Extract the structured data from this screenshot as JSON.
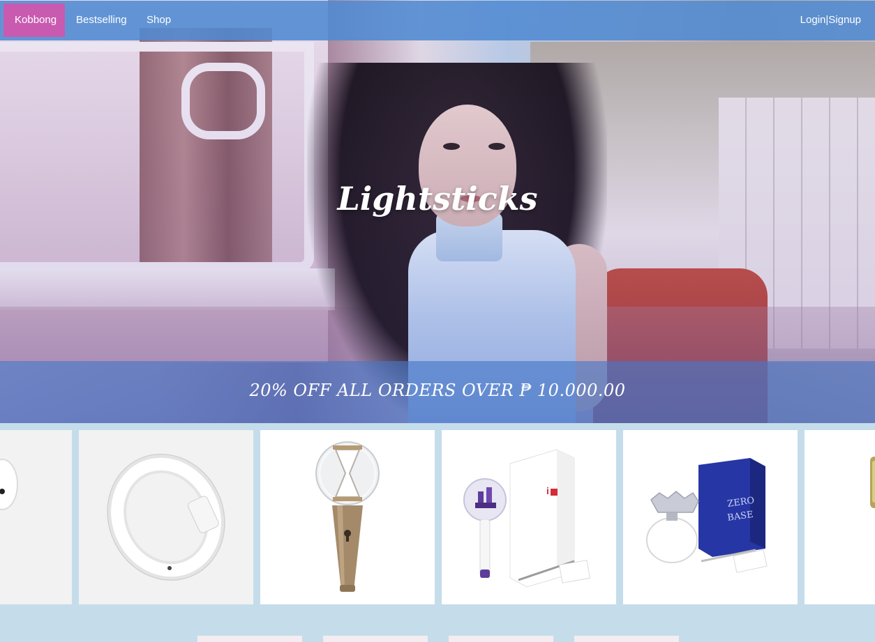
{
  "nav": {
    "brand": "Kobbong",
    "links": [
      "Bestselling",
      "Shop"
    ],
    "auth": {
      "login": "Login",
      "separator": "|",
      "signup": "Signup"
    }
  },
  "hero": {
    "title": "Lightsticks",
    "promo": "20% OFF ALL ORDERS OVER ₱ 10.000.00"
  },
  "products": [
    {
      "name": "lightstick-white-partial"
    },
    {
      "name": "lightstick-ring"
    },
    {
      "name": "lightstick-hourglass"
    },
    {
      "name": "lightstick-castle"
    },
    {
      "name": "lightstick-flower"
    },
    {
      "name": "lightstick-gold-partial"
    }
  ],
  "colors": {
    "nav_bg": "#508ad2",
    "brand_bg": "#c85bb0",
    "page_bg": "#c5ddea",
    "promo_bg": "#4678c8"
  }
}
